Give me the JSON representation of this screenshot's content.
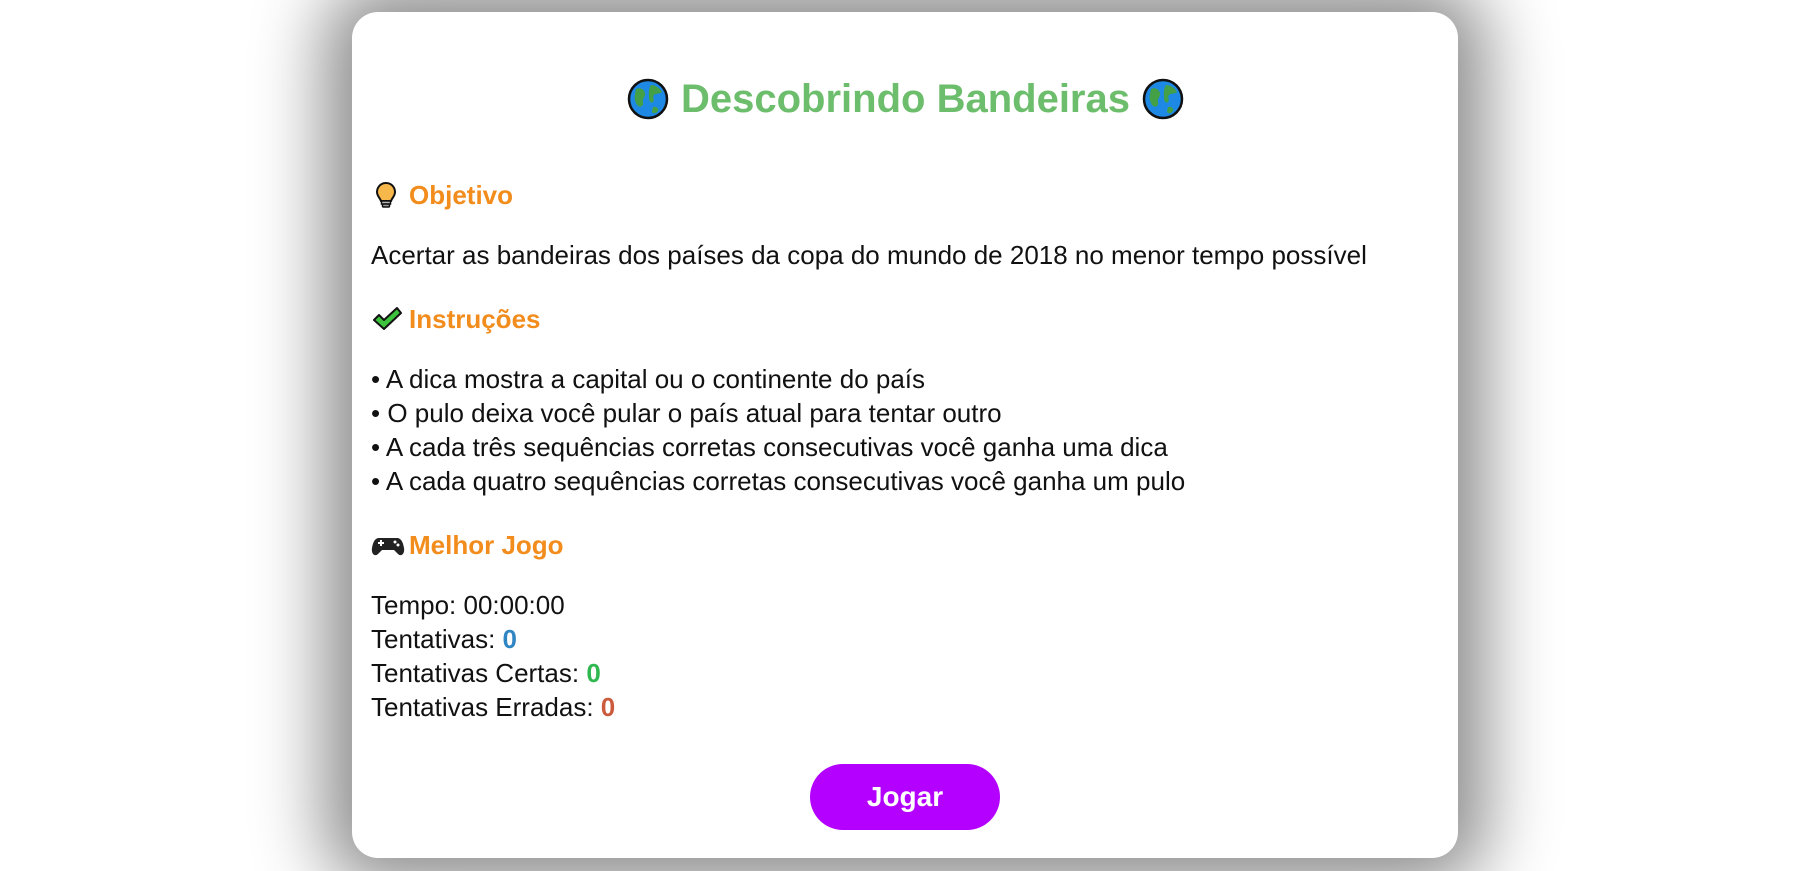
{
  "title": "Descobrindo Bandeiras",
  "icons": {
    "title_left": "globe-icon",
    "title_right": "globe-icon",
    "objective": "lightbulb-icon",
    "instructions": "checkmark-icon",
    "best_game": "gamepad-icon"
  },
  "colors": {
    "title": "#6cbd6c",
    "section_heading": "#f28c1c",
    "attempts": "#2f86c3",
    "correct": "#2fb84f",
    "wrong": "#cc5a3c",
    "play_button": "#b400ff"
  },
  "objective": {
    "heading": "Objetivo",
    "text": "Acertar as bandeiras dos países da copa do mundo de 2018 no menor tempo possível"
  },
  "instructions": {
    "heading": "Instruções",
    "items": [
      "A dica mostra a capital ou o continente do país",
      "O pulo deixa você pular o país atual para tentar outro",
      "A cada três sequências corretas consecutivas você ganha uma dica",
      "A cada quatro sequências corretas consecutivas você ganha um pulo"
    ]
  },
  "best_game": {
    "heading": "Melhor Jogo",
    "time_label": "Tempo: 00:00:00",
    "attempts_label": "Tentativas:",
    "attempts_value": "0",
    "correct_label": "Tentativas Certas:",
    "correct_value": "0",
    "wrong_label": "Tentativas Erradas:",
    "wrong_value": "0"
  },
  "play_button": "Jogar"
}
